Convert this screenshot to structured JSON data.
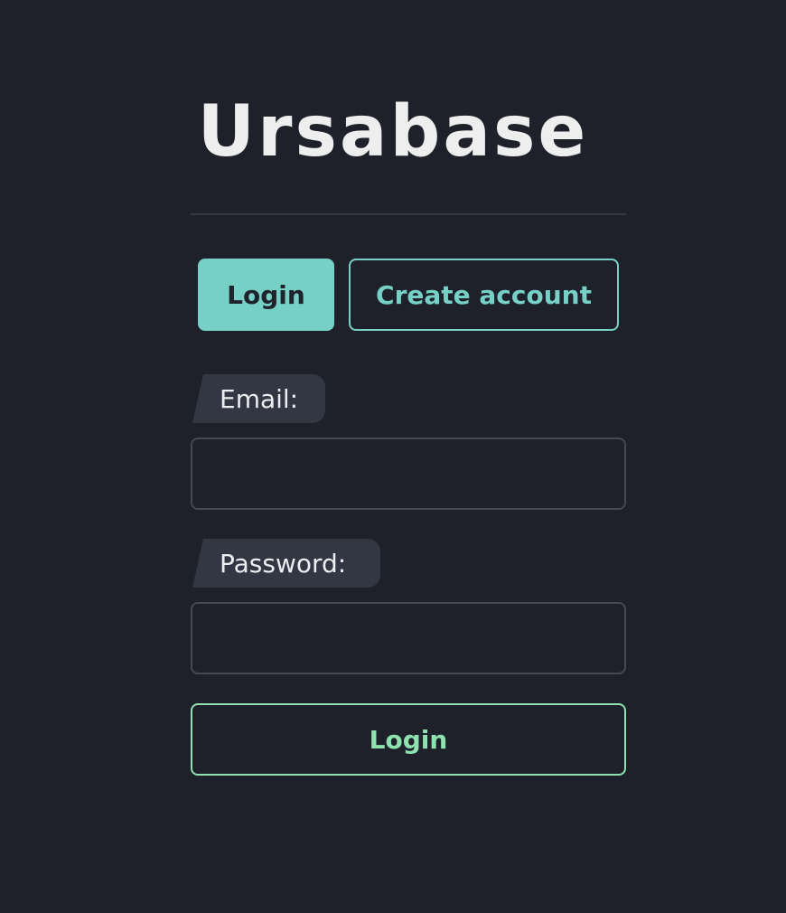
{
  "app": {
    "logo_text": "Ursabase"
  },
  "tabs": {
    "login_label": "Login",
    "create_account_label": "Create account",
    "active": "Login"
  },
  "form": {
    "email_label": "Email:",
    "email_value": "",
    "password_label": "Password:",
    "password_value": "",
    "submit_label": "Login"
  },
  "colors": {
    "background": "#1e212a",
    "accent_teal": "#77d0c6",
    "submit_green": "#8fe1b0",
    "label_bg": "#333743",
    "input_border": "#444955"
  }
}
